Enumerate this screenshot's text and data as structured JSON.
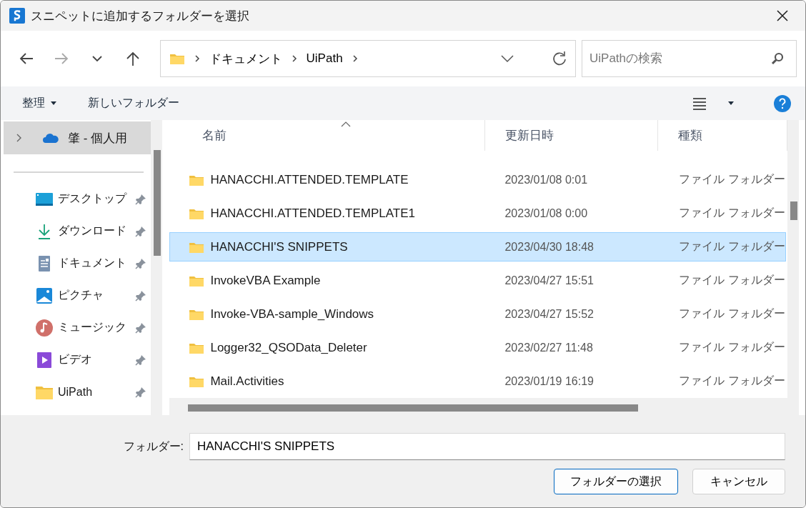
{
  "window": {
    "title": "スニペットに追加するフォルダーを選択"
  },
  "nav": {
    "back": {
      "disabled": false
    },
    "forward": {
      "disabled": true
    },
    "path": [
      "ドキュメント",
      "UiPath"
    ],
    "search": {
      "placeholder": "UiPathの検索"
    }
  },
  "toolbar": {
    "organize": "整理",
    "new_folder": "新しいフォルダー"
  },
  "sidebar": {
    "account": {
      "label": "肇 - 個人用",
      "selected": true
    },
    "items": [
      {
        "label": "デスクトップ",
        "kind": "desktop",
        "pinned": true
      },
      {
        "label": "ダウンロード",
        "kind": "download",
        "pinned": true
      },
      {
        "label": "ドキュメント",
        "kind": "documents",
        "pinned": true
      },
      {
        "label": "ピクチャ",
        "kind": "pictures",
        "pinned": true
      },
      {
        "label": "ミュージック",
        "kind": "music",
        "pinned": true
      },
      {
        "label": "ビデオ",
        "kind": "videos",
        "pinned": true
      },
      {
        "label": "UiPath",
        "kind": "folder",
        "pinned": true
      }
    ]
  },
  "table": {
    "columns": [
      {
        "label": "名前",
        "sorted": true
      },
      {
        "label": "更新日時",
        "sorted": false
      },
      {
        "label": "種類",
        "sorted": false
      }
    ],
    "rows": [
      {
        "name": "HANACCHI.ATTENDED.TEMPLATE",
        "modified": "2023/01/08 0:01",
        "type": "ファイル フォルダー",
        "selected": false
      },
      {
        "name": "HANACCHI.ATTENDED.TEMPLATE1",
        "modified": "2023/01/08 0:00",
        "type": "ファイル フォルダー",
        "selected": false
      },
      {
        "name": "HANACCHI'S SNIPPETS",
        "modified": "2023/04/30 18:48",
        "type": "ファイル フォルダー",
        "selected": true
      },
      {
        "name": "InvokeVBA Example",
        "modified": "2023/04/27 15:51",
        "type": "ファイル フォルダー",
        "selected": false
      },
      {
        "name": "Invoke-VBA-sample_Windows",
        "modified": "2023/04/27 15:52",
        "type": "ファイル フォルダー",
        "selected": false
      },
      {
        "name": "Logger32_QSOData_Deleter",
        "modified": "2023/02/27 11:48",
        "type": "ファイル フォルダー",
        "selected": false
      },
      {
        "name": "Mail.Activities",
        "modified": "2023/01/19 16:19",
        "type": "ファイル フォルダー",
        "selected": false
      }
    ]
  },
  "footer": {
    "folder_label": "フォルダー:",
    "folder_value": "HANACCHI'S SNIPPETS",
    "buttons": [
      {
        "label": "フォルダーの選択",
        "primary": true
      },
      {
        "label": "キャンセル",
        "primary": false
      }
    ]
  }
}
